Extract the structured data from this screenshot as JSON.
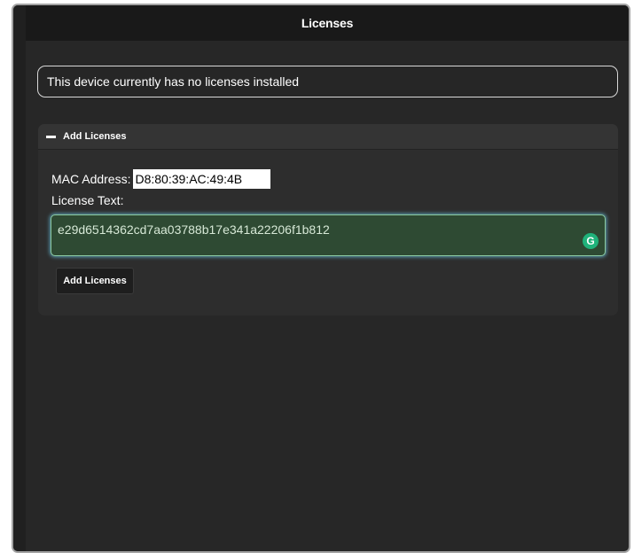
{
  "window": {
    "title": "Licenses"
  },
  "notice": {
    "text": "This device currently has no licenses installed"
  },
  "add_panel": {
    "header_label": "Add Licenses",
    "header_icon": "minus-icon",
    "mac_label": "MAC Address:",
    "mac_value": "D8:80:39:AC:49:4B",
    "license_label": "License Text:",
    "license_value": "e29d6514362cd7aa03788b17e341a22206f1b812",
    "grammarly_icon": "grammarly-icon",
    "button_label": "Add Licenses"
  },
  "colors": {
    "background": "#272727",
    "titlebar": "#191919",
    "textarea_bg": "#2e4a33",
    "textarea_focus": "#5aa0b4",
    "grammarly": "#1fb27a"
  }
}
